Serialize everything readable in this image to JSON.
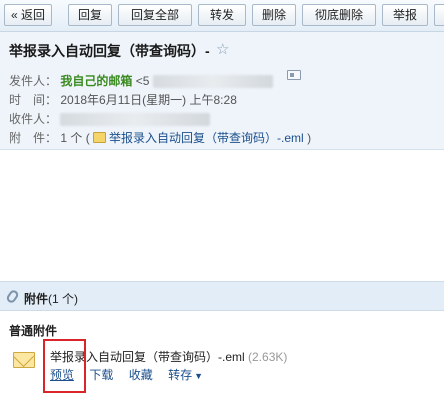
{
  "toolbar": {
    "back": "« 返回",
    "reply": "回复",
    "reply_all": "回复全部",
    "forward": "转发",
    "delete": "删除",
    "delete_permanent": "彻底删除",
    "report": "举报"
  },
  "mail": {
    "subject": "举报录入自动回复（带查询码）-",
    "star": "☆",
    "sender_label": "发件人：",
    "sender_name": "我自己的邮箱",
    "sender_open": "<5",
    "time_label": "时　间：",
    "time_value": "2018年6月11日(星期一) 上午8:28",
    "recipient_label": "收件人：",
    "attachment_label": "附　件：",
    "attachment_count": "1 个 (",
    "attachment_link": "举报录入自动回复（带查询码）-.eml",
    "attachment_close": ")"
  },
  "attachments": {
    "bar_title": "附件",
    "bar_count": "(1 个)",
    "section_label": "普通附件",
    "file_name": "举报录入自动回复（带查询码）-.eml",
    "file_size": "(2.63K)",
    "actions": {
      "preview": "预览",
      "download": "下载",
      "collect": "收藏",
      "save_to": "转存"
    }
  },
  "icons": {
    "star": "star-icon",
    "contact_card": "contact-card-icon",
    "eml_file": "eml-file-icon",
    "paperclip": "paperclip-icon",
    "envelope": "envelope-icon",
    "caret": "chevron-down-icon"
  },
  "colors": {
    "highlight_box": "#d9252a",
    "sender_name": "#3a8a20",
    "link": "#1c4f8c"
  }
}
